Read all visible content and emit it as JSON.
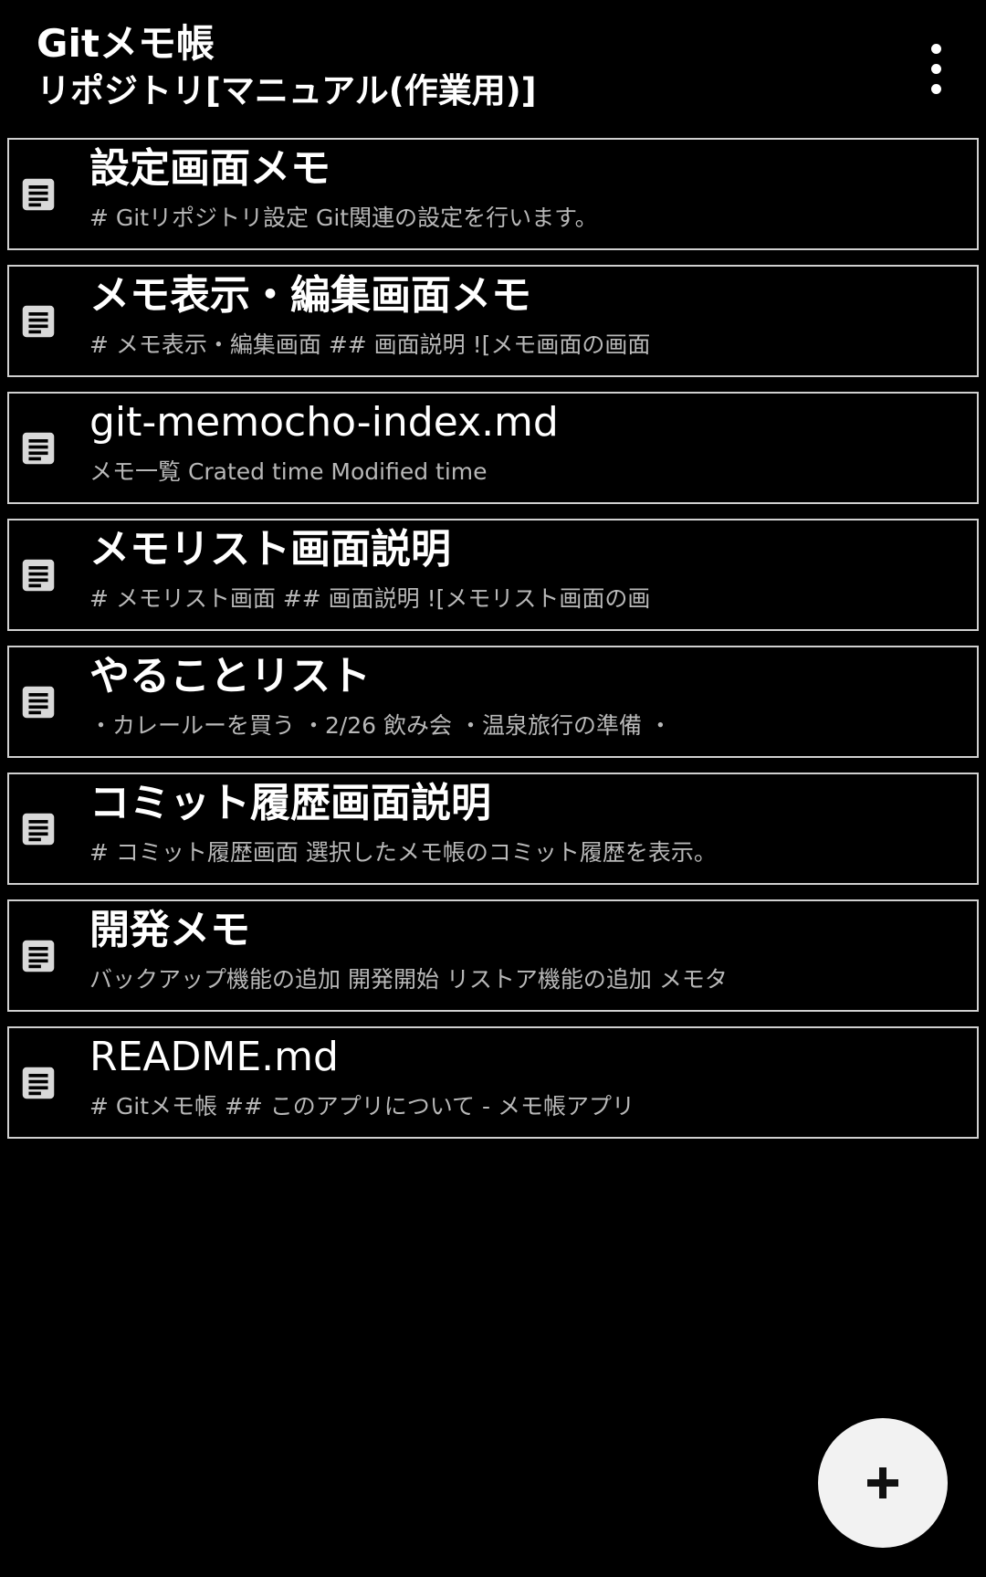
{
  "app_bar": {
    "title": "Gitメモ帳",
    "subtitle": "リポジトリ[マニュアル(作業用)]",
    "overflow_icon": "more-vert-icon"
  },
  "memos": [
    {
      "title": "設定画面メモ",
      "preview": "# Gitリポジトリ設定 Git関連の設定を行います。",
      "icon": "document-icon"
    },
    {
      "title": "メモ表示・編集画面メモ",
      "preview": "# メモ表示・編集画面  ## 画面説明 ![メモ画面の画面",
      "icon": "document-icon"
    },
    {
      "title": "git-memocho-index.md",
      "preview": "メモ一覧 Crated time  Modified time",
      "icon": "document-icon"
    },
    {
      "title": "メモリスト画面説明",
      "preview": "# メモリスト画面  ## 画面説明 ![メモリスト画面の画",
      "icon": "document-icon"
    },
    {
      "title": "やることリスト",
      "preview": "・カレールーを買う ・2/26 飲み会 ・温泉旅行の準備 ・",
      "icon": "document-icon"
    },
    {
      "title": "コミット履歴画面説明",
      "preview": "# コミット履歴画面 選択したメモ帳のコミット履歴を表示。",
      "icon": "document-icon"
    },
    {
      "title": "開発メモ",
      "preview": "バックアップ機能の追加 開発開始 リストア機能の追加 メモタ",
      "icon": "document-icon"
    },
    {
      "title": "README.md",
      "preview": "# Gitメモ帳 ## このアプリについて - メモ帳アプリ",
      "icon": "document-icon"
    }
  ],
  "fab": {
    "icon": "plus-icon"
  },
  "colors": {
    "background": "#000000",
    "text": "#ffffff",
    "preview_text": "#b8b8b8",
    "item_border": "#d0d0d0",
    "icon": "#d9d9d9",
    "fab_background": "#f2f2f2"
  }
}
